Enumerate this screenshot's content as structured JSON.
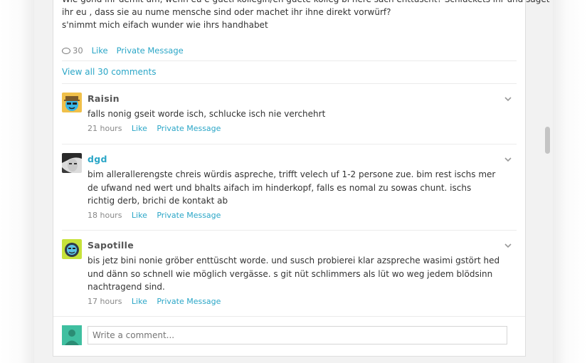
{
  "post": {
    "text_line1": "Wie gönd ihr demit um, wenn eu e gueti kollegin/en guete kolleg bi nere sach enttüscht? Schluckets ihr und saget",
    "text_line2": "ihr eu , dass sie au nume mensche sind oder machet ihr ihne direkt vorwürf?",
    "text_line3": "s'nimmt mich eifach wunder wie ihrs handhabet",
    "comment_count": "30",
    "like_label": "Like",
    "pm_label": "Private Message"
  },
  "view_all_label": "View all 30 comments",
  "comments": [
    {
      "name": "Raisin",
      "text": "falls nonig gseit worde isch, schlucke isch nie verchehrt",
      "time": "21 hours",
      "like": "Like",
      "pm": "Private Message"
    },
    {
      "name": "dgd",
      "text": "bim allerallerengste chreis würdis aspreche, trifft velech uf 1-2 persone zue. bim rest ischs mer de ufwand ned wert und bhalts aifach im hinderkopf, falls es nomal zu sowas chunt. ischs richtig derb, brichi de kontakt ab",
      "time": "18 hours",
      "like": "Like",
      "pm": "Private Message"
    },
    {
      "name": "Sapotille",
      "text": "bis jetz bini nonie gröber enttüscht worde. und susch probierei klar azspreche wasimi gstört hed und dänn so schnell wie möglich vergässe. s git nüt schlimmers als lüt wo weg jedem blödsinn nachtragend sind.",
      "time": "17 hours",
      "like": "Like",
      "pm": "Private Message"
    }
  ],
  "composer": {
    "placeholder": "Write a comment..."
  },
  "colors": {
    "link": "#2aa6c7",
    "background": "#f2f2f2",
    "card": "#ffffff"
  },
  "icons": [
    "speech-bubble-icon",
    "chevron-down-icon"
  ]
}
